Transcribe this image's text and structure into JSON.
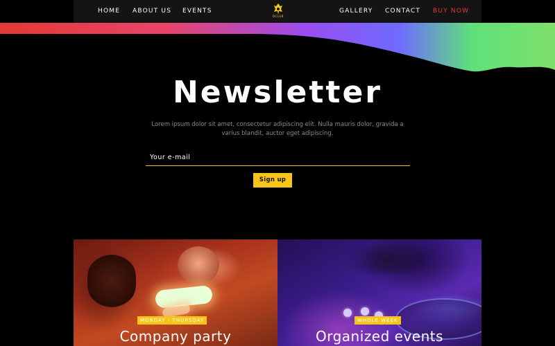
{
  "nav": {
    "links_left": [
      "HOME",
      "ABOUT US",
      "EVENTS"
    ],
    "links_right": [
      "GALLERY",
      "CONTACT",
      "BUY NOW"
    ],
    "logo_text": "DCLUB",
    "logo_icon": "club-logo-icon"
  },
  "newsletter": {
    "title": "Newsletter",
    "description": "Lorem ipsum dolor sit amet, consectetur adipiscing elit. Nulla mauris dolor, gravida a varius blandit, auctor eget adipiscing.",
    "email_placeholder": "Your e-mail",
    "signup_label": "Sign up"
  },
  "cards": [
    {
      "tag": "MONDAY - THURSDAY",
      "title": "Company party"
    },
    {
      "tag": "WHOLE WEEK",
      "title": "Organized events"
    }
  ],
  "colors": {
    "accent": "#f5c518",
    "buy_now": "#e53935",
    "wave_left": "#e53935",
    "wave_mid": "#b04cff",
    "wave_right": "#5fe07a"
  }
}
